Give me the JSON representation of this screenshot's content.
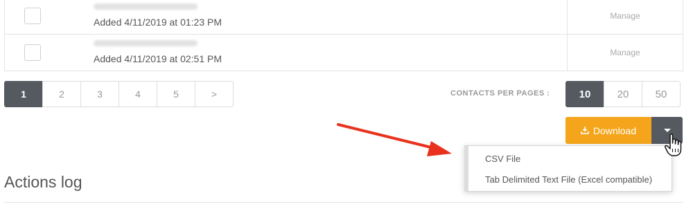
{
  "contacts": {
    "rows": [
      {
        "added": "Added 4/11/2019 at 01:23 PM",
        "action": "Manage"
      },
      {
        "added": "Added 4/11/2019 at 02:51 PM",
        "action": "Manage"
      }
    ]
  },
  "pagination": {
    "pages": [
      "1",
      "2",
      "3",
      "4",
      "5",
      ">"
    ],
    "active": "1"
  },
  "per_page": {
    "label": "CONTACTS PER PAGES :",
    "options": [
      "10",
      "20",
      "50"
    ],
    "active": "10"
  },
  "download": {
    "label": "Download",
    "icon": "download-icon",
    "toggle_icon": "caret-down-icon",
    "menu": [
      "CSV File",
      "Tab Delimited Text File (Excel compatible)"
    ]
  },
  "actions_log": {
    "title": "Actions log"
  },
  "colors": {
    "accent": "#f5a51b",
    "dark": "#555a61",
    "arrow": "#e8321e"
  }
}
